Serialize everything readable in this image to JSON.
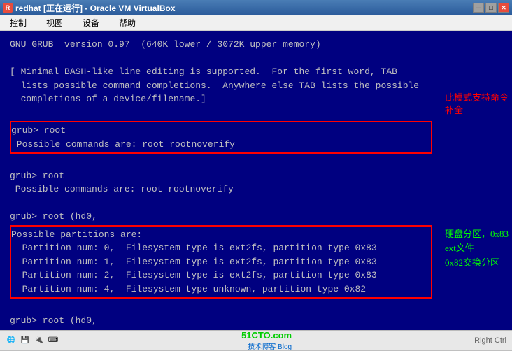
{
  "titlebar": {
    "title": "redhat [正在运行] - Oracle VM VirtualBox",
    "icon_label": "R",
    "min_label": "─",
    "max_label": "□",
    "close_label": "✕"
  },
  "menubar": {
    "items": [
      "控制",
      "视图",
      "设备",
      "帮助"
    ]
  },
  "terminal": {
    "line1": "GNU GRUB  version 0.97  (640K lower / 3072K upper memory)",
    "line2": "",
    "line3": "[ Minimal BASH-like line editing is supported.  For the first word, TAB",
    "line4": "  lists possible command completions.  Anywhere else TAB lists the possible",
    "line5": "  completions of a device/filename.]",
    "line6": "",
    "highlighted1_line1": "grub> root",
    "highlighted1_line2": " Possible commands are: root rootnoverify",
    "line7": "",
    "line8": "grub> root",
    "line9": " Possible commands are: root rootnoverify",
    "line10": "",
    "line11": "grub> root (hd0,",
    "highlighted2_line1": "Possible partitions are:",
    "highlighted2_line2": "  Partition num: 0,  Filesystem type is ext2fs, partition type 0x83",
    "highlighted2_line3": "  Partition num: 1,  Filesystem type is ext2fs, partition type 0x83",
    "highlighted2_line4": "  Partition num: 2,  Filesystem type is ext2fs, partition type 0x83",
    "highlighted2_line5": "  Partition num: 4,  Filesystem type unknown, partition type 0x82",
    "line12": "",
    "line13": "grub> root (hd0,_"
  },
  "annotations": {
    "red_text": "此模式支持命令补全",
    "green_text1": "硬盘分区，0x83",
    "green_text2": "ext文件",
    "green_text3": "0x82交换分区"
  },
  "statusbar": {
    "icons": [
      "🌐",
      "💾",
      "🔌",
      "⌨"
    ],
    "watermark": "51CTO.com",
    "sub_text": "技术博客  Blog",
    "right_text": "Right Ctrl"
  }
}
